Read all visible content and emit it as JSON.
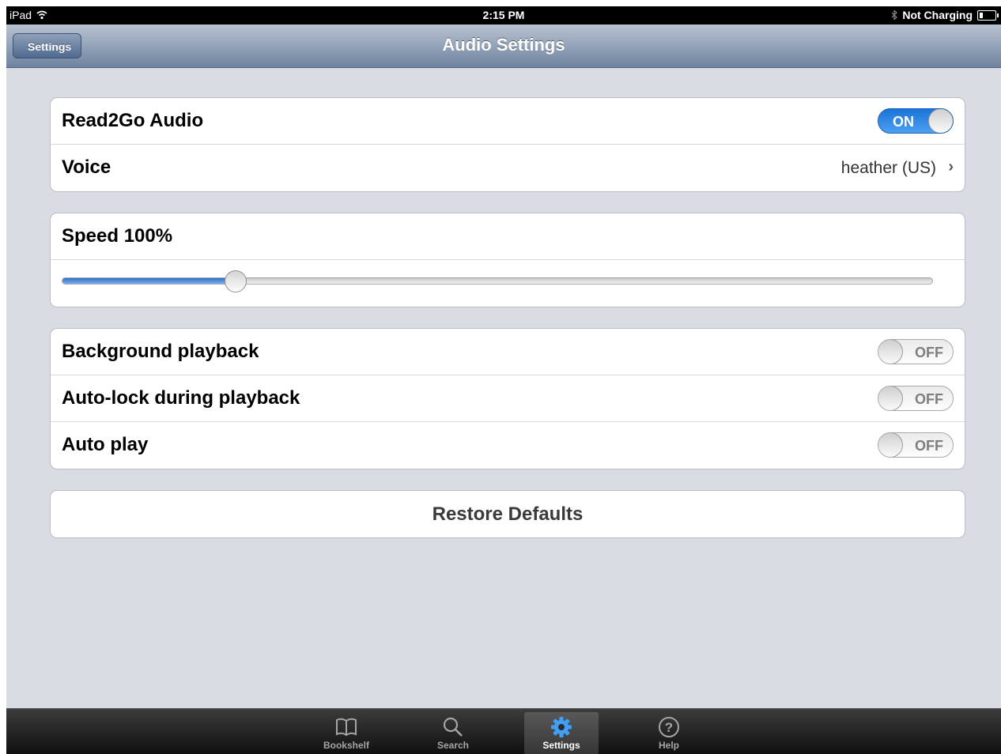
{
  "status_bar": {
    "device": "iPad",
    "time": "2:15 PM",
    "battery_status": "Not Charging"
  },
  "nav_bar": {
    "back_label": "Settings",
    "title": "Audio Settings"
  },
  "groups": {
    "audio": {
      "read2go_label": "Read2Go Audio",
      "read2go_state": "ON",
      "voice_label": "Voice",
      "voice_value": "heather (US)"
    },
    "speed": {
      "label": "Speed 100%",
      "slider_fraction": 0.2
    },
    "playback": {
      "background_label": "Background playback",
      "background_state": "OFF",
      "autolock_label": "Auto-lock during playback",
      "autolock_state": "OFF",
      "autoplay_label": "Auto play",
      "autoplay_state": "OFF"
    },
    "restore_label": "Restore Defaults"
  },
  "tab_bar": {
    "items": [
      {
        "label": "Bookshelf",
        "icon": "book-icon"
      },
      {
        "label": "Search",
        "icon": "search-icon"
      },
      {
        "label": "Settings",
        "icon": "gear-icon",
        "active": true
      },
      {
        "label": "Help",
        "icon": "help-icon"
      }
    ]
  },
  "colors": {
    "nav_gradient_top": "#b8c3d1",
    "nav_gradient_bottom": "#6f83a0",
    "switch_on": "#1a74d8",
    "background": "#d9dce2"
  }
}
